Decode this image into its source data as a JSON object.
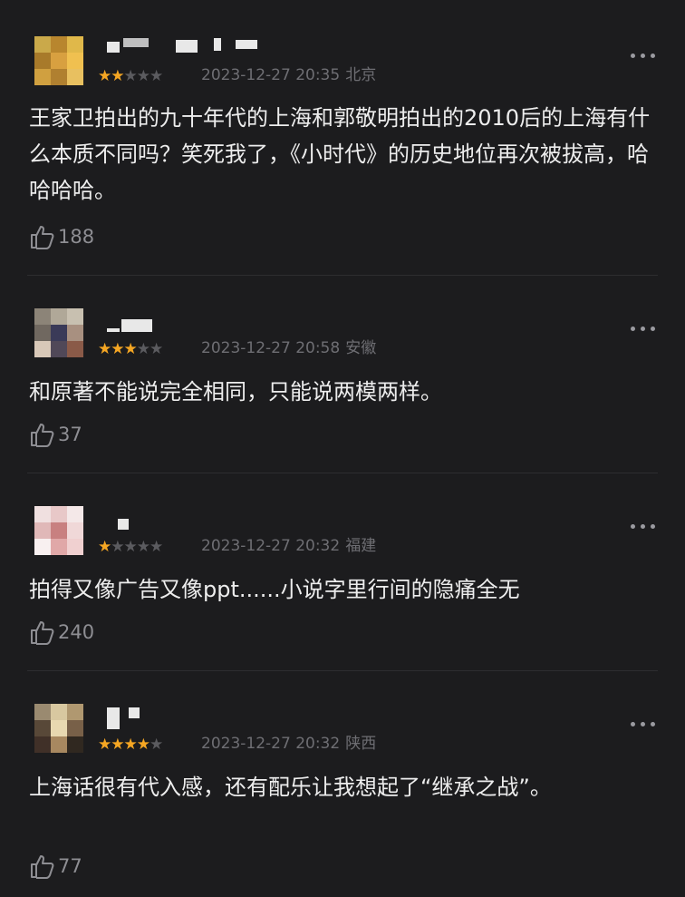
{
  "comments": [
    {
      "rating": 2,
      "time": "2023-12-27 20:35",
      "location": "北京",
      "text": "王家卫拍出的九十年代的上海和郭敬明拍出的2010后的上海有什么本质不同吗？笑死我了，《小时代》的历史地位再次被拔高，哈哈哈哈。",
      "likes": "188"
    },
    {
      "rating": 3,
      "time": "2023-12-27 20:58",
      "location": "安徽",
      "text": "和原著不能说完全相同，只能说两模两样。",
      "likes": "37"
    },
    {
      "rating": 1,
      "time": "2023-12-27 20:32",
      "location": "福建",
      "text": "拍得又像广告又像ppt......小说字里行间的隐痛全无",
      "likes": "240"
    },
    {
      "rating": 4,
      "time": "2023-12-27 20:32",
      "location": "陕西",
      "text": "上海话很有代入感，还有配乐让我想起了“继承之战”。",
      "likes": "77"
    }
  ],
  "icons": {
    "like": "thumbs-up-icon",
    "more": "more-dots-icon",
    "star": "star-icon"
  },
  "colors": {
    "background": "#1c1c1e",
    "star_on": "#f5a623",
    "star_off": "#5b5b5f",
    "text": "#ededed",
    "meta": "#6e6e73"
  }
}
